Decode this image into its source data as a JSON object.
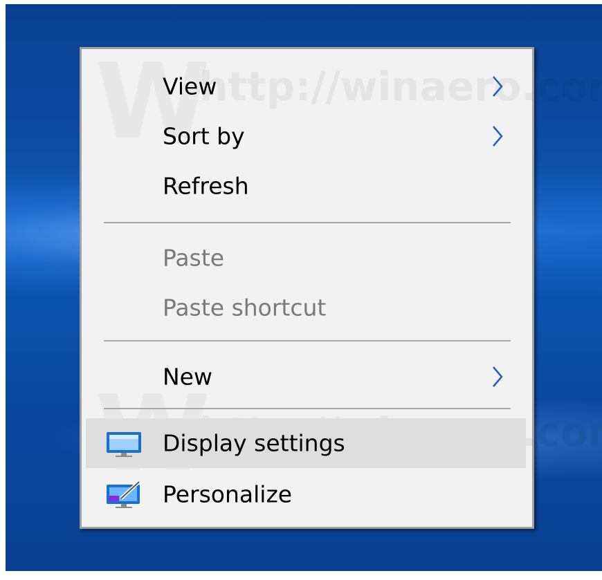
{
  "context_menu": {
    "items": [
      {
        "label": "View",
        "has_submenu": true,
        "enabled": true
      },
      {
        "label": "Sort by",
        "has_submenu": true,
        "enabled": true
      },
      {
        "label": "Refresh",
        "has_submenu": false,
        "enabled": true
      },
      {
        "label": "Paste",
        "has_submenu": false,
        "enabled": false
      },
      {
        "label": "Paste shortcut",
        "has_submenu": false,
        "enabled": false
      },
      {
        "label": "New",
        "has_submenu": true,
        "enabled": true
      },
      {
        "label": "Display settings",
        "has_submenu": false,
        "enabled": true,
        "icon": "display-icon",
        "highlighted": true
      },
      {
        "label": "Personalize",
        "has_submenu": false,
        "enabled": true,
        "icon": "personalize-icon"
      }
    ]
  },
  "watermark": "http://winaero.com",
  "colors": {
    "menu_background": "#f2f2f2",
    "highlight": "#dedede",
    "disabled_text": "#7a7a7a",
    "submenu_arrow": "#1f5fbf",
    "desktop_blue": "#0d4fa7"
  }
}
